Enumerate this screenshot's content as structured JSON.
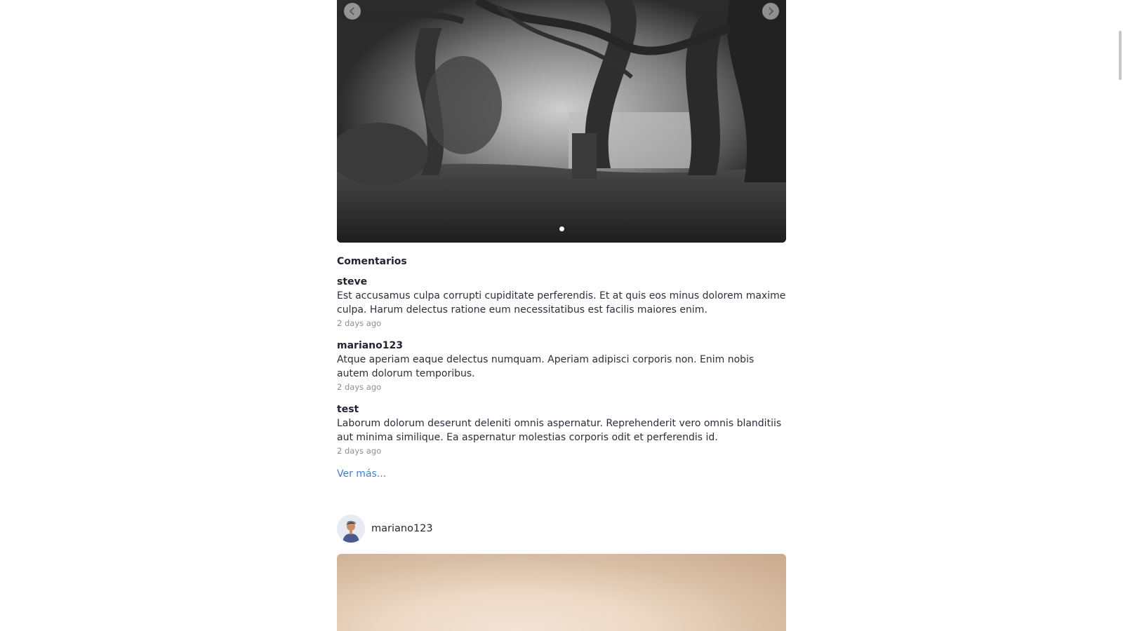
{
  "carousel": {
    "prev_icon": "chevron-left-icon",
    "next_icon": "chevron-right-icon",
    "slide_count": 1,
    "active_slide": 1
  },
  "comments": {
    "title": "Comentarios",
    "items": [
      {
        "user": "steve",
        "text": "Est accusamus culpa corrupti cupiditate perferendis. Et at quis eos minus dolorem maxime culpa. Harum delectus ratione eum necessitatibus est facilis maiores enim.",
        "time": "2 days ago"
      },
      {
        "user": "mariano123",
        "text": "Atque aperiam eaque delectus numquam. Aperiam adipisci corporis non. Enim nobis autem dolorum temporibus.",
        "time": "2 days ago"
      },
      {
        "user": "test",
        "text": "Laborum dolorum deserunt deleniti omnis aspernatur. Reprehenderit vero omnis blanditiis aut minima similique. Ea aspernatur molestias corporis odit et perferendis id.",
        "time": "2 days ago"
      }
    ],
    "see_more": "Ver más..."
  },
  "next_post": {
    "username": "mariano123"
  },
  "colors": {
    "link": "#3b82d6",
    "text": "#1f2430",
    "muted": "#8a8f99"
  }
}
